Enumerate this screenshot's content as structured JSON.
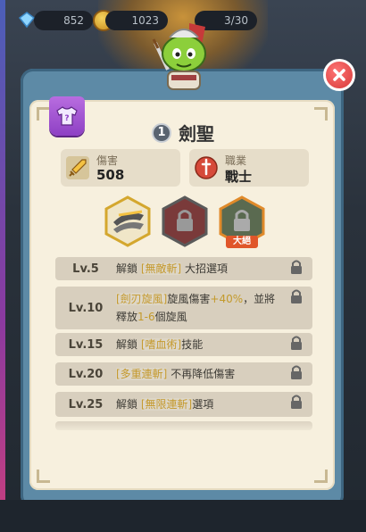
{
  "resources": {
    "gems": "852",
    "gold": "1023",
    "energy": "3/30"
  },
  "hero": {
    "level": "1",
    "name": "劍聖"
  },
  "stats": {
    "damage_label": "傷害",
    "damage_value": "508",
    "class_label": "職業",
    "class_value": "戰士"
  },
  "skills": [
    {
      "name": "sword-skill",
      "locked": false
    },
    {
      "name": "locked-skill",
      "locked": true
    },
    {
      "name": "ultimate-skill",
      "locked": true,
      "badge": "大絕"
    }
  ],
  "levels": [
    {
      "lv": "Lv.5",
      "parts": [
        "解鎖",
        "[無敵斬]",
        "大招選項"
      ]
    },
    {
      "lv": "Lv.10",
      "parts": [
        "[劍刃旋風]",
        "旋風傷害",
        "+40%",
        "，並將",
        "釋放",
        "1-6",
        "個旋風"
      ]
    },
    {
      "lv": "Lv.15",
      "parts": [
        "解鎖",
        "[嗜血術]",
        "技能"
      ]
    },
    {
      "lv": "Lv.20",
      "parts": [
        "[多重連斬]",
        "不再降低傷害"
      ]
    },
    {
      "lv": "Lv.25",
      "parts": [
        "解鎖",
        "[無限連斬]",
        "選項"
      ]
    }
  ],
  "colors": {
    "accent": "#c59a2e",
    "panel": "#5d8aa6",
    "close": "#d63a3a"
  }
}
